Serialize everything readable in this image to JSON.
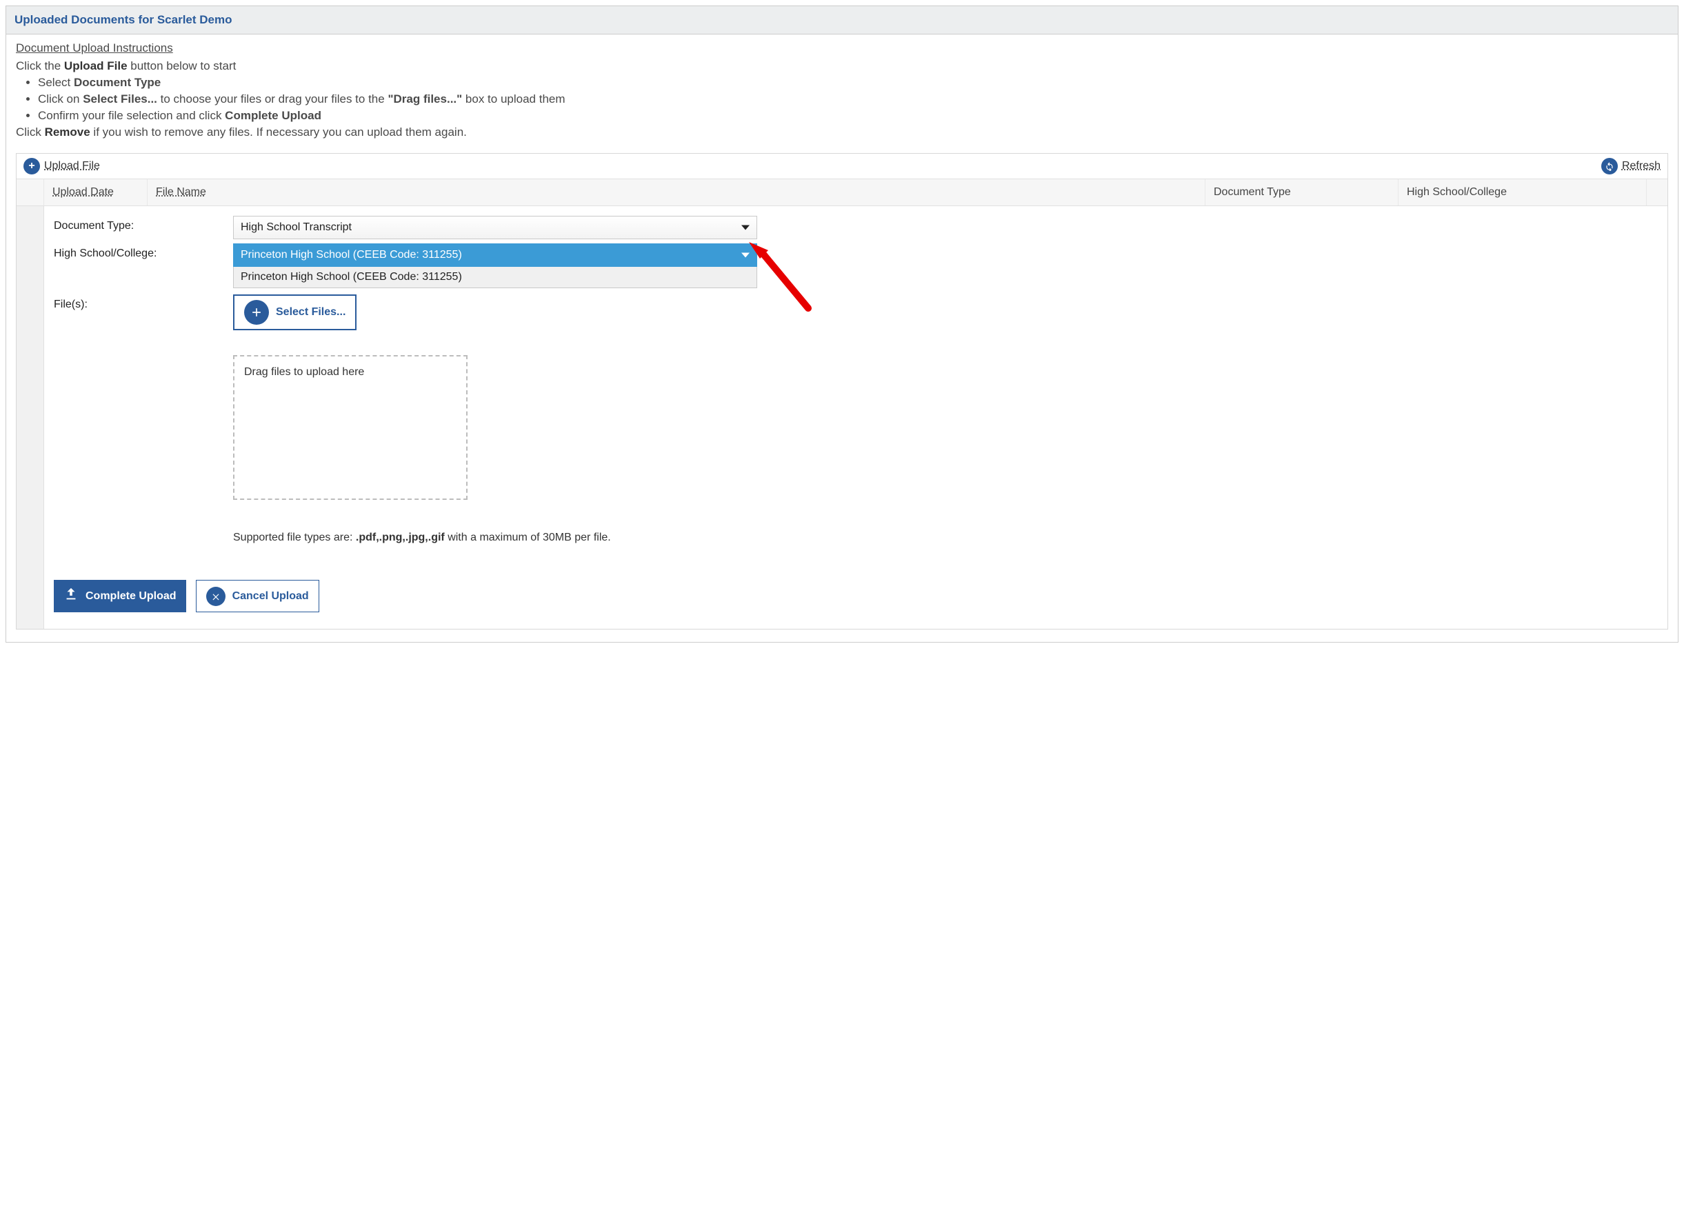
{
  "header": {
    "title": "Uploaded Documents for Scarlet Demo"
  },
  "instructions": {
    "title": "Document Upload Instructions",
    "line1_pre": "Click the ",
    "line1_bold": "Upload File",
    "line1_post": " button below to start",
    "bullets": {
      "b1_pre": "Select ",
      "b1_bold": "Document Type",
      "b2_pre": "Click on ",
      "b2_bold": "Select Files...",
      "b2_mid": " to choose your files or drag your files to the ",
      "b2_bold2": "\"Drag files...\"",
      "b2_post": " box to upload them",
      "b3_pre": "Confirm your file selection and click ",
      "b3_bold": "Complete Upload"
    },
    "line_remove_pre": "Click ",
    "line_remove_bold": "Remove",
    "line_remove_post": " if you wish to remove any files. If necessary you can upload them again."
  },
  "toolbar": {
    "upload_label": "Upload File",
    "refresh_label": "Refresh"
  },
  "grid_headers": {
    "upload_date": "Upload Date",
    "file_name": "File Name",
    "document_type": "Document Type",
    "school": "High School/College"
  },
  "form": {
    "doc_type_label": "Document Type:",
    "doc_type_value": "High School Transcript",
    "school_label": "High School/College:",
    "school_value": "Princeton High School (CEEB Code: 311255)",
    "school_option_1": "Princeton High School (CEEB Code: 311255)",
    "files_label": "File(s):",
    "select_files_label": "Select Files...",
    "dropzone_text": "Drag files to upload here",
    "support_pre": "Supported file types are: ",
    "support_bold": ".pdf,.png,.jpg,.gif",
    "support_post": " with a maximum of 30MB per file."
  },
  "actions": {
    "complete": "Complete Upload",
    "cancel": "Cancel Upload"
  }
}
